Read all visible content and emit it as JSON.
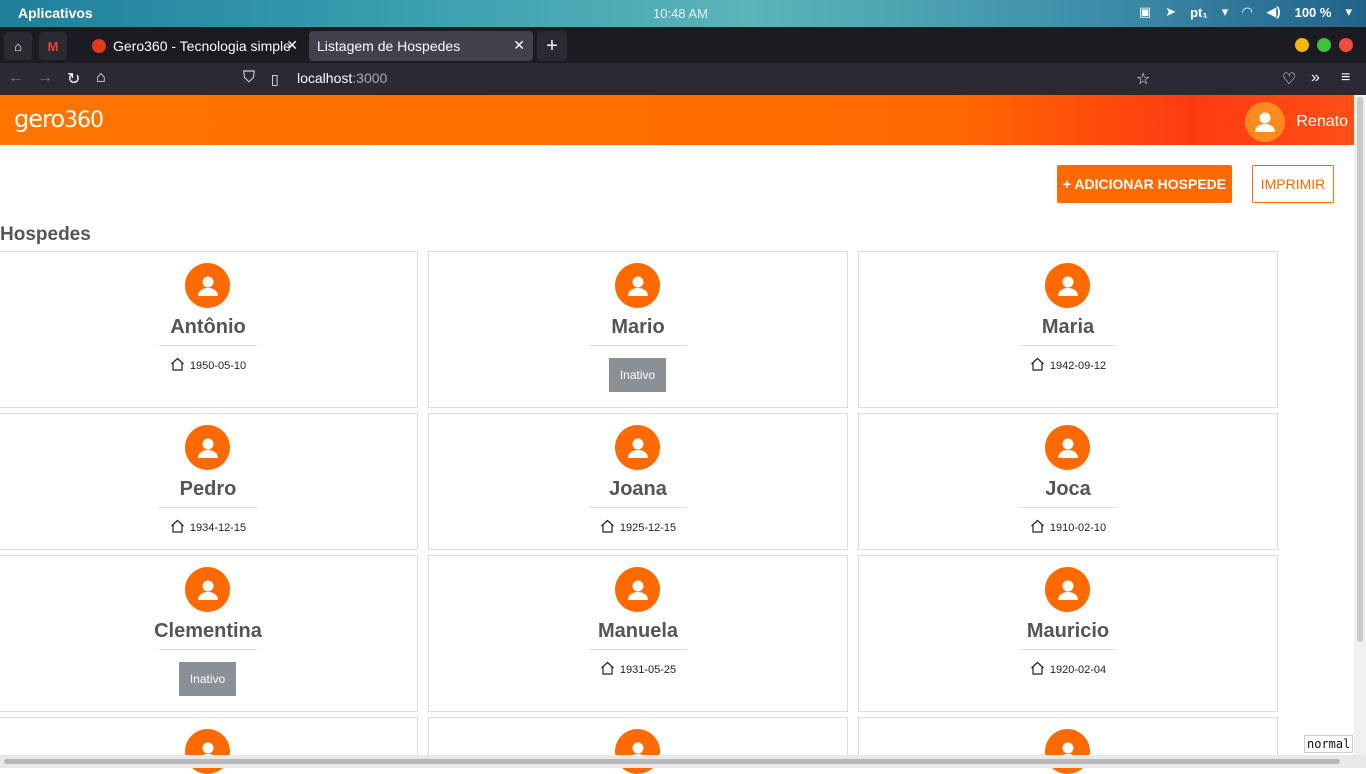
{
  "os": {
    "apps_label": "Aplicativos",
    "clock": "10:48 AM",
    "lang": "pt₁",
    "battery": "100 %"
  },
  "browser": {
    "tabs": [
      {
        "label": "Gero360 - Tecnologia simple"
      },
      {
        "label": "Listagem de Hospedes"
      }
    ],
    "url_host": "localhost",
    "url_port": ":3000"
  },
  "header": {
    "logo_a": "gero",
    "logo_b": "360",
    "user_name": "Renato"
  },
  "actions": {
    "add_label": "+ ADICIONAR HOSPEDE",
    "print_label": "IMPRIMIR"
  },
  "section_title": "Hospedes",
  "guests": [
    {
      "name": "Antônio",
      "date": "1950-05-10",
      "status": ""
    },
    {
      "name": "Mario",
      "date": "",
      "status": "Inativo"
    },
    {
      "name": "Maria",
      "date": "1942-09-12",
      "status": ""
    },
    {
      "name": "Pedro",
      "date": "1934-12-15",
      "status": ""
    },
    {
      "name": "Joana",
      "date": "1925-12-15",
      "status": ""
    },
    {
      "name": "Joca",
      "date": "1910-02-10",
      "status": ""
    },
    {
      "name": "Clementina",
      "date": "",
      "status": "Inativo"
    },
    {
      "name": "Manuela",
      "date": "1931-05-25",
      "status": ""
    },
    {
      "name": "Mauricio",
      "date": "1920-02-04",
      "status": ""
    }
  ],
  "mode_indicator": "normal"
}
